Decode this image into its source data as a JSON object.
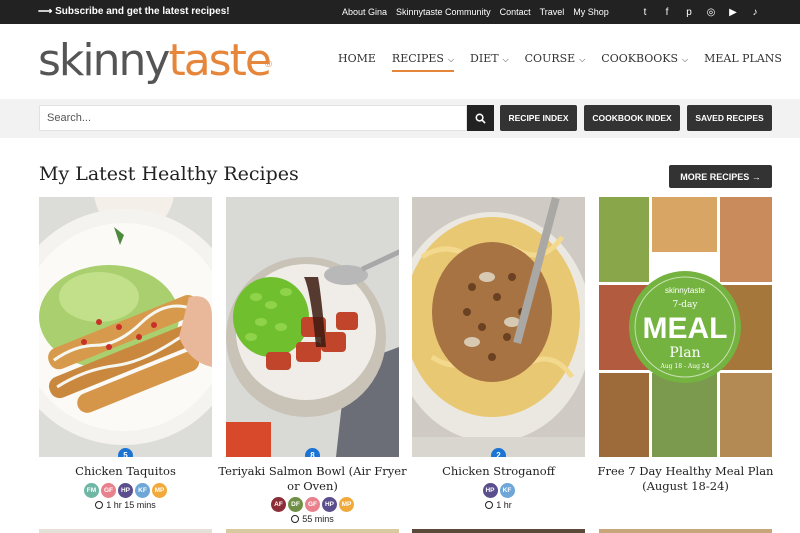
{
  "topbar": {
    "promo": "⟶ Subscribe and get the latest recipes!",
    "links": [
      "About Gina",
      "Skinnytaste Community",
      "Contact",
      "Travel",
      "My Shop"
    ],
    "social": [
      {
        "icon": "twitter-icon",
        "glyph": "t"
      },
      {
        "icon": "facebook-icon",
        "glyph": "f"
      },
      {
        "icon": "pinterest-icon",
        "glyph": "p"
      },
      {
        "icon": "instagram-icon",
        "glyph": "◎"
      },
      {
        "icon": "youtube-icon",
        "glyph": "▶"
      },
      {
        "icon": "tiktok-icon",
        "glyph": "♪"
      }
    ]
  },
  "logo": {
    "part1": "skinny",
    "part2": "taste",
    "reg": "®"
  },
  "nav": [
    {
      "label": "HOME",
      "dropdown": false
    },
    {
      "label": "RECIPES",
      "dropdown": true
    },
    {
      "label": "DIET",
      "dropdown": true
    },
    {
      "label": "COURSE",
      "dropdown": true
    },
    {
      "label": "COOKBOOKS",
      "dropdown": true
    },
    {
      "label": "MEAL PLANS",
      "dropdown": false
    }
  ],
  "search": {
    "placeholder": "Search..."
  },
  "buttons": {
    "recipe_index": "RECIPE INDEX",
    "cookbook_index": "COOKBOOK INDEX",
    "saved_recipes": "SAVED RECIPES"
  },
  "section": {
    "title": "My Latest Healthy Recipes",
    "more": "MORE RECIPES →"
  },
  "cards": [
    {
      "title": "Chicken Taquitos",
      "count": "5",
      "tags": [
        "FM",
        "GF",
        "HP",
        "KF",
        "MP"
      ],
      "time": "1 hr 15 mins"
    },
    {
      "title": "Teriyaki Salmon Bowl (Air Fryer or Oven)",
      "count": "8",
      "tags": [
        "AF",
        "DF",
        "GF",
        "HP",
        "MP"
      ],
      "time": "55 mins"
    },
    {
      "title": "Chicken Stroganoff",
      "count": "2",
      "tags": [
        "HP",
        "KF"
      ],
      "time": "1 hr"
    },
    {
      "title": "Free 7 Day Healthy Meal Plan (August 18-24)",
      "count": "",
      "tags": [],
      "time": ""
    }
  ],
  "meal_plan_overlay": {
    "brand": "skinnytaste",
    "line1": "7-day",
    "line2": "MEAL",
    "line3": "Plan",
    "dates": "Aug 18 - Aug 24"
  },
  "colors": {
    "accent": "#e6863a",
    "dark": "#333333",
    "badge_blue": "#1b74d4"
  },
  "tag_colors": {
    "FM": "#6fb7a4",
    "GF": "#e8818c",
    "HP": "#5a4e8c",
    "KF": "#6fa6d8",
    "MP": "#f2a93b",
    "AF": "#8b2c36",
    "DF": "#6f8f46"
  }
}
